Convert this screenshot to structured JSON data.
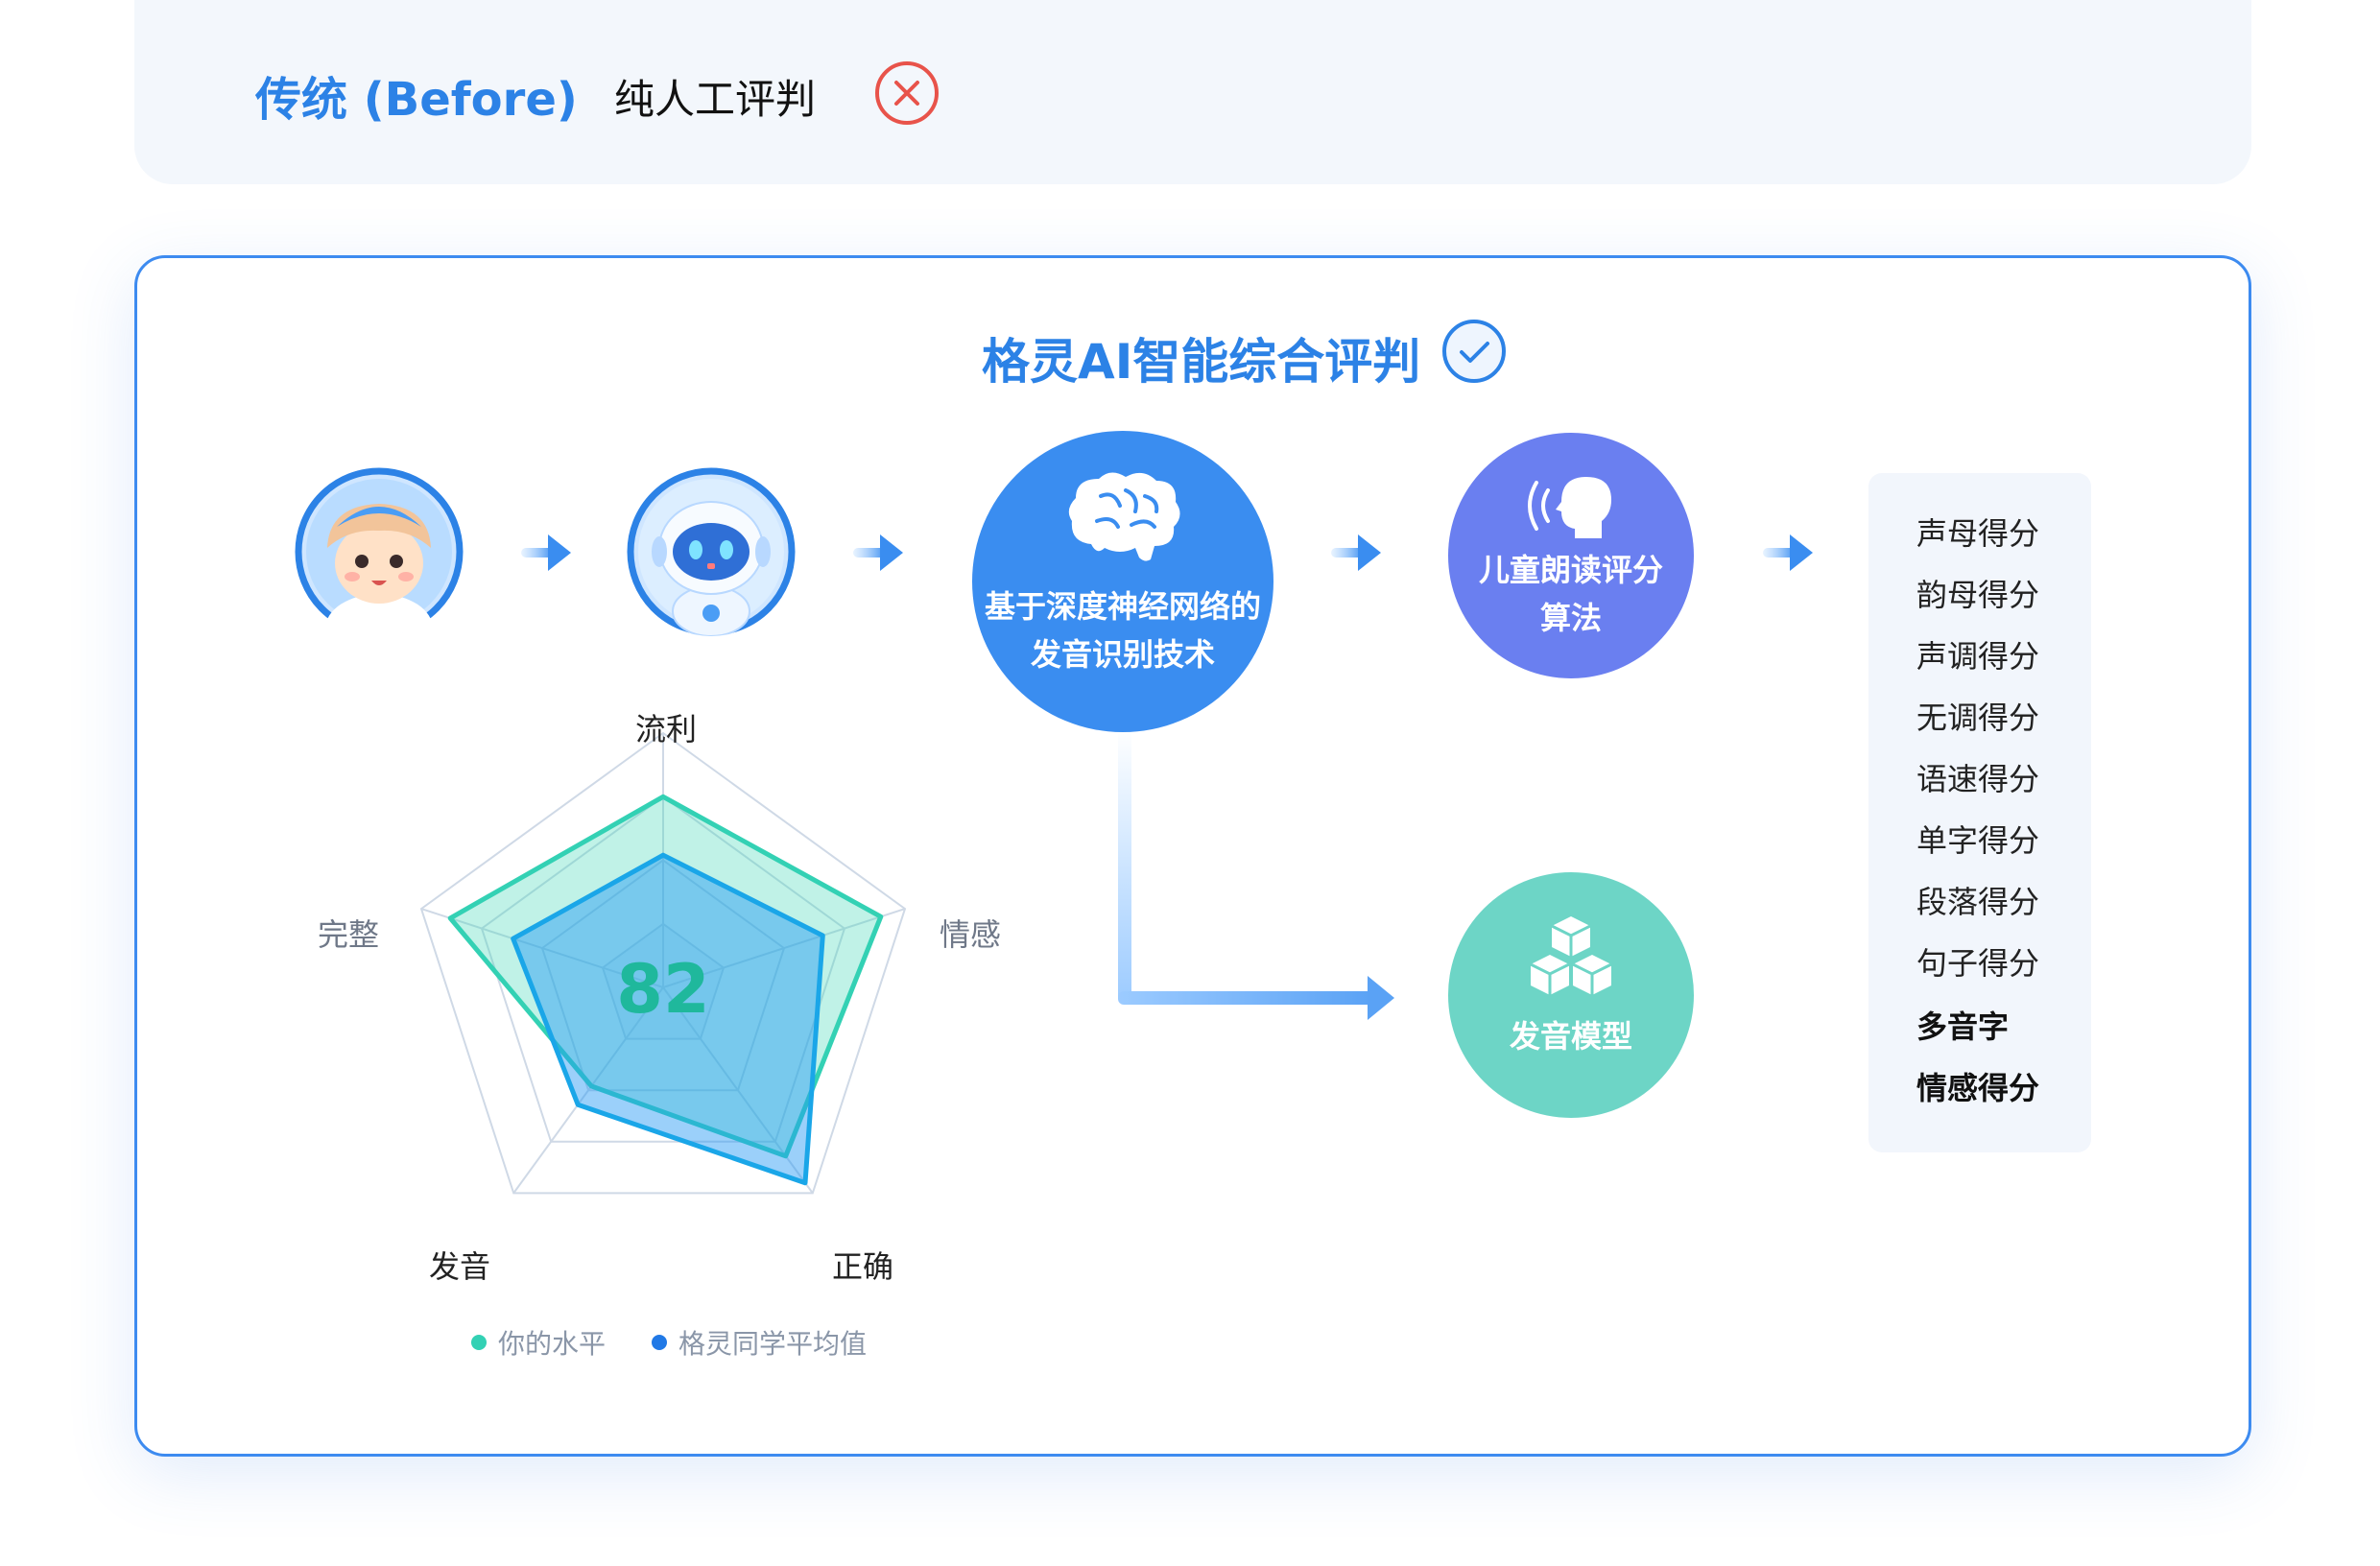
{
  "before_bar": {
    "title": "传统 (Before)",
    "text": "纯人工评判",
    "status_icon": "close-circle-icon"
  },
  "card": {
    "title": "格灵AI智能综合评判",
    "title_icon": "check-circle-icon"
  },
  "flow": {
    "nodes": [
      {
        "id": "child",
        "icon": "child-avatar"
      },
      {
        "id": "robot",
        "icon": "robot-avatar"
      },
      {
        "id": "recognition",
        "icon": "brain-icon",
        "label_lines": [
          "基于深度神经网络的",
          "发音识别技术"
        ]
      },
      {
        "id": "algorithm",
        "icon": "speaking-head-icon",
        "label_lines": [
          "儿童朗读评分",
          "算法"
        ]
      },
      {
        "id": "model",
        "icon": "cubes-icon",
        "label_lines": [
          "发音模型"
        ]
      }
    ],
    "arrow_icon": "arrow-right-icon"
  },
  "scores": {
    "items": [
      "声母得分",
      "韵母得分",
      "声调得分",
      "无调得分",
      "语速得分",
      "单字得分",
      "段落得分",
      "句子得分",
      "多音字",
      "情感得分"
    ],
    "bold_items": [
      "多音字",
      "情感得分"
    ]
  },
  "chart_data": {
    "type": "radar",
    "axes": [
      "流利",
      "情感",
      "正确",
      "发音",
      "完整"
    ],
    "center_value": "82",
    "series": [
      {
        "name": "你的水平",
        "values": [
          0.75,
          0.9,
          0.82,
          0.48,
          0.88
        ]
      },
      {
        "name": "格灵同学平均值",
        "values": [
          0.52,
          0.66,
          0.95,
          0.57,
          0.62
        ]
      }
    ],
    "grid_levels": 4,
    "legend_position": "bottom"
  },
  "colors": {
    "brand_blue": "#2c82e6",
    "node_blue": "#3a8df0",
    "node_purple": "#6a7ff0",
    "node_teal": "#6dd5c6",
    "error_red": "#e8534a",
    "series_you": "#33d1b4",
    "series_avg": "#2196f3"
  }
}
